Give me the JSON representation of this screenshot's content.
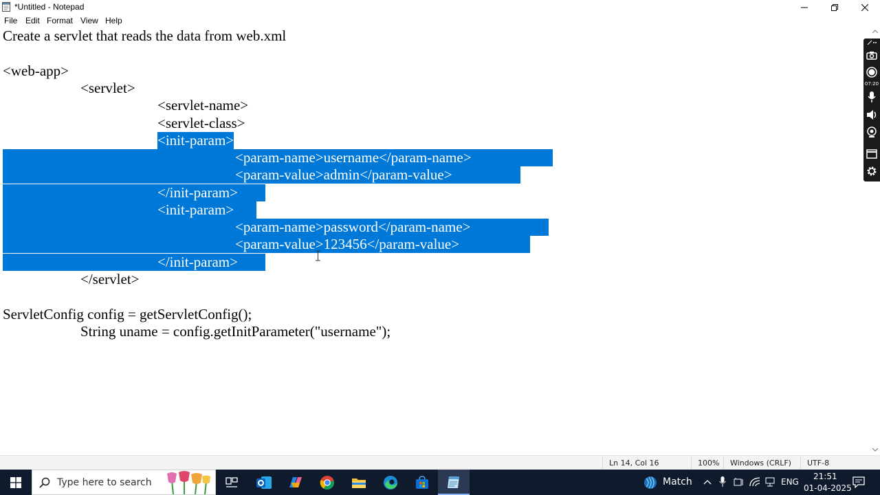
{
  "window": {
    "title": "*Untitled - Notepad",
    "minimize_icon": "minimize-icon",
    "maximize_icon": "restore-icon",
    "close_icon": "close-icon"
  },
  "menu": {
    "file": "File",
    "edit": "Edit",
    "format": "Format",
    "view": "View",
    "help": "Help"
  },
  "editor": {
    "selection_color": "#0078d7",
    "lines": [
      "Create a servlet that reads the data from web.xml",
      "",
      "<web-app>",
      "\t<servlet>",
      "\t\t<servlet-name>",
      "\t\t<servlet-class>",
      "\t\t<init-param>",
      "\t\t\t<param-name>username</param-name>",
      "\t\t\t<param-value>admin</param-value>",
      "\t\t</init-param>",
      "\t\t<init-param>",
      "\t\t\t<param-name>password</param-name>",
      "\t\t\t<param-value>123456</param-value>",
      "\t\t</init-param>",
      "\t</servlet>",
      "",
      "ServletConfig config = getServletConfig();",
      "\tString uname = config.getInitParameter(\"username\");"
    ]
  },
  "recorder_toolbar": {
    "time": "07:20",
    "icons": [
      "pen-icon",
      "camera-icon",
      "record-icon",
      "microphone-icon",
      "speaker-icon",
      "webcam-icon",
      "window-icon",
      "settings-icon"
    ]
  },
  "statusbar": {
    "position": "Ln 14, Col 16",
    "zoom": "100%",
    "line_ending": "Windows (CRLF)",
    "encoding": "UTF-8"
  },
  "taskbar": {
    "search_placeholder": "Type here to search",
    "apps": [
      "task-view-icon",
      "outlook-icon",
      "copilot-icon",
      "chrome-icon",
      "file-explorer-icon",
      "edge-icon",
      "store-icon",
      "notepad-icon"
    ],
    "weather_label": "Match",
    "language": "ENG",
    "time": "21:51",
    "date": "01-04-2025"
  }
}
